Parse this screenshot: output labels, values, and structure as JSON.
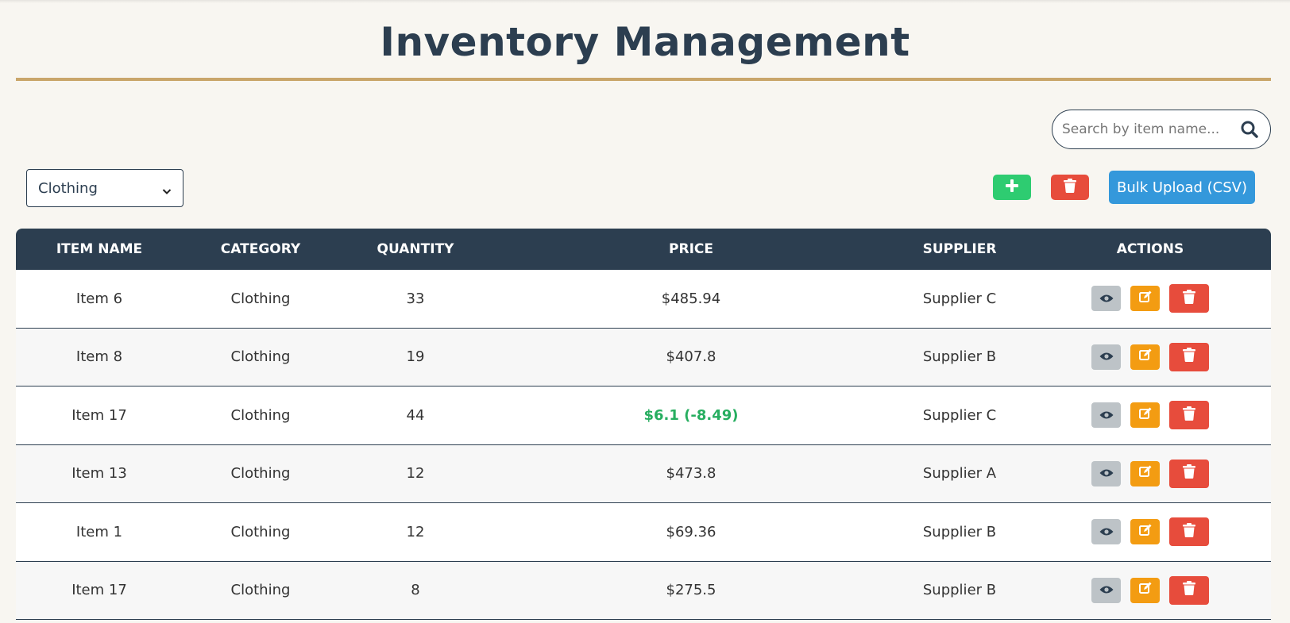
{
  "header": {
    "title": "Inventory Management"
  },
  "search": {
    "placeholder": "Search by item name...",
    "value": ""
  },
  "filter": {
    "selected": "Clothing"
  },
  "toolbar": {
    "bulk_upload_label": "Bulk Upload (CSV)"
  },
  "colors": {
    "navy": "#2c3e50",
    "gold": "#c9a66b",
    "green": "#2ecc71",
    "red": "#e74c3c",
    "blue": "#3498db",
    "orange": "#f39c12",
    "gray": "#bdc3c7",
    "price_highlight": "#27ae60"
  },
  "icons": {
    "add": "plus-icon",
    "delete_all": "trash-icon",
    "search": "search-icon",
    "view": "eye-icon",
    "edit": "edit-icon",
    "delete": "trash-icon",
    "select": "chevron-down-icon"
  },
  "table": {
    "headers": [
      "ITEM NAME",
      "CATEGORY",
      "QUANTITY",
      "PRICE",
      "SUPPLIER",
      "ACTIONS"
    ],
    "rows": [
      {
        "name": "Item 6",
        "category": "Clothing",
        "quantity": "33",
        "price": "$485.94",
        "supplier": "Supplier C"
      },
      {
        "name": "Item 8",
        "category": "Clothing",
        "quantity": "19",
        "price": "$407.8",
        "supplier": "Supplier B"
      },
      {
        "name": "Item 17",
        "category": "Clothing",
        "quantity": "44",
        "price": "$6.1 (-8.49)",
        "supplier": "Supplier C"
      },
      {
        "name": "Item 13",
        "category": "Clothing",
        "quantity": "12",
        "price": "$473.8",
        "supplier": "Supplier A"
      },
      {
        "name": "Item 1",
        "category": "Clothing",
        "quantity": "12",
        "price": "$69.36",
        "supplier": "Supplier B"
      },
      {
        "name": "Item 17",
        "category": "Clothing",
        "quantity": "8",
        "price": "$275.5",
        "supplier": "Supplier B"
      }
    ]
  }
}
